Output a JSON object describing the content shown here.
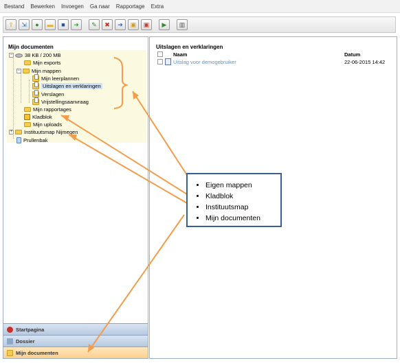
{
  "menu": [
    "Bestand",
    "Bewerken",
    "Invoegen",
    "Ga naar",
    "Rapportage",
    "Extra"
  ],
  "toolbar": {
    "buttons": [
      {
        "icon": "folder-up-icon",
        "glyph": "⇧",
        "color": "#d4a017"
      },
      {
        "icon": "import-icon",
        "glyph": "⇲",
        "color": "#2e6aa8"
      },
      {
        "icon": "globe-icon",
        "glyph": "●",
        "color": "#2f8f2f"
      },
      {
        "icon": "open-folder-icon",
        "glyph": "▬",
        "color": "#e0b030"
      },
      {
        "icon": "save-icon",
        "glyph": "■",
        "color": "#2d4f9e"
      },
      {
        "icon": "green-arrow-icon",
        "glyph": "➜",
        "color": "#3aa33a"
      },
      {
        "icon": "edit-icon",
        "glyph": "✎",
        "color": "#2f8f2f"
      },
      {
        "icon": "delete-icon",
        "glyph": "✖",
        "color": "#c0302a"
      },
      {
        "icon": "move-icon",
        "glyph": "➔",
        "color": "#2e6aa8"
      },
      {
        "icon": "folder-user-icon",
        "glyph": "▣",
        "color": "#d49a1c"
      },
      {
        "icon": "folder-lock-icon",
        "glyph": "▣",
        "color": "#c0402a"
      },
      {
        "icon": "export-icon",
        "glyph": "▶",
        "color": "#2f8f2f"
      },
      {
        "icon": "columns-icon",
        "glyph": "▥",
        "color": "#555555"
      }
    ]
  },
  "tree": {
    "title": "Mijn documenten",
    "quota": "38 KB / 200 MB",
    "items": {
      "exports": "Mijn exports",
      "mappen": "Mijn mappen",
      "leerplannen": "Mijn leerplannen",
      "uitslagen": "Uitslagen en verklaringen",
      "verslagen": "Verslagen",
      "vrijstelling": "Vrijstellingsaanvraag",
      "rapportages": "Mijn rapportages",
      "kladblok": "Kladblok",
      "uploads": "Mijn uploads",
      "instituut": "Instituutsmap Nijmegen",
      "prullenbak": "Prullenbak"
    }
  },
  "accordion": {
    "startpagina": "Startpagina",
    "dossier": "Dossier",
    "mijn_documenten": "Mijn documenten"
  },
  "content": {
    "title": "Uitslagen en verklaringen",
    "col_name": "Naam",
    "col_date": "Datum",
    "rows": [
      {
        "name": "Uitslag voor demogebruiker",
        "date": "22-06-2015 14:42"
      }
    ]
  },
  "legend": [
    "Eigen mappen",
    "Kladblok",
    "Instituutsmap",
    "Mijn documenten"
  ],
  "colors": {
    "annotation": "#f39c4a",
    "legend_border": "#3a5f8c",
    "highlight": "#fbf9e0",
    "selected": "#cfe3f6",
    "link": "#6a8fc0",
    "active_tab": "#fdcf8c"
  }
}
